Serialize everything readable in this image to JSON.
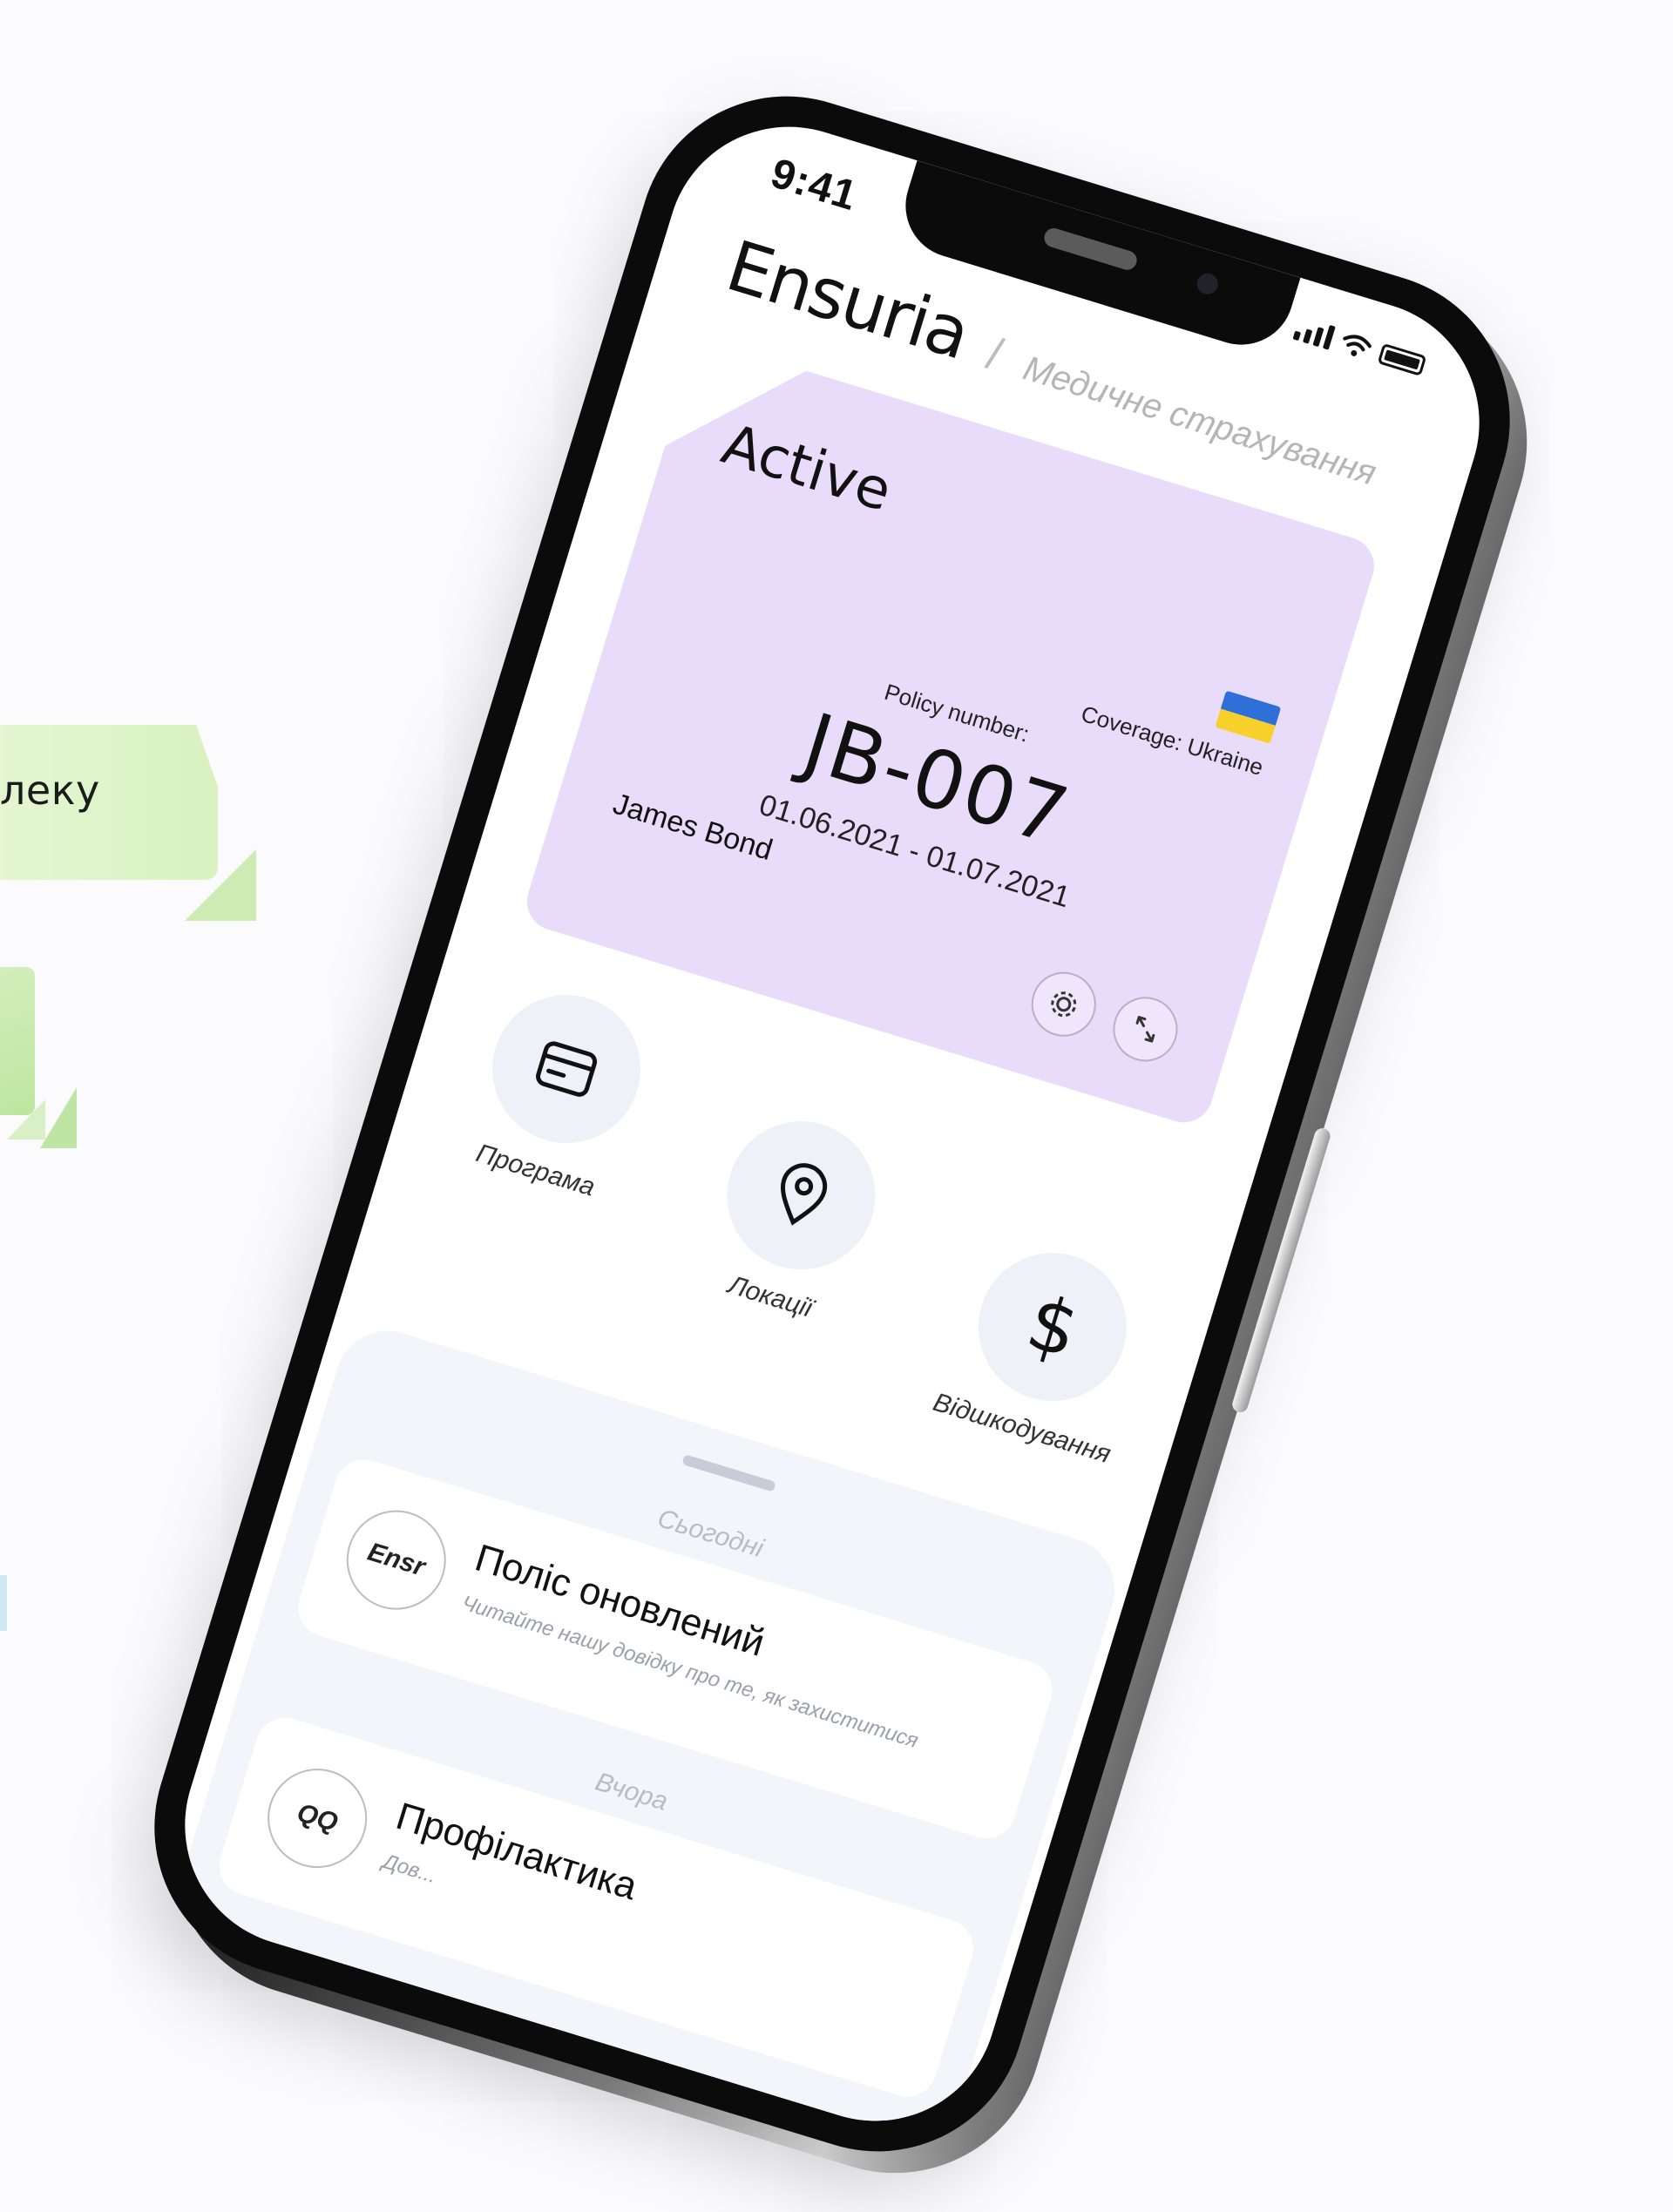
{
  "promo": {
    "text": "леку"
  },
  "status_bar": {
    "time": "9:41"
  },
  "header": {
    "brand": "Ensuria",
    "divider": "/",
    "subtitle": "Медичне страхування"
  },
  "policy_card": {
    "status": "Active",
    "coverage_label": "Coverage: Ukraine",
    "policy_label": "Policy number:",
    "policy_number": "JB-007",
    "period": "01.06.2021 - 01.07.2021",
    "holder": "James Bond",
    "flag_colors": {
      "top": "#2f6fd8",
      "bottom": "#f7d02b"
    },
    "background": "#e9dcfb"
  },
  "quick_actions": [
    {
      "label": "Програма",
      "icon": "card-icon"
    },
    {
      "label": "Локації",
      "icon": "location-pin-icon"
    },
    {
      "label": "Відшкодування",
      "icon": "dollar-icon"
    }
  ],
  "feed": {
    "today_label": "Сьогодні",
    "yesterday_label": "Вчора",
    "items": [
      {
        "avatar": "Ensr",
        "title": "Поліс оновлений",
        "description": "Читайте нашу довідку про те, як захиститися"
      },
      {
        "avatar": "QQ",
        "title": "Профілактика",
        "description": "Дов..."
      }
    ]
  }
}
